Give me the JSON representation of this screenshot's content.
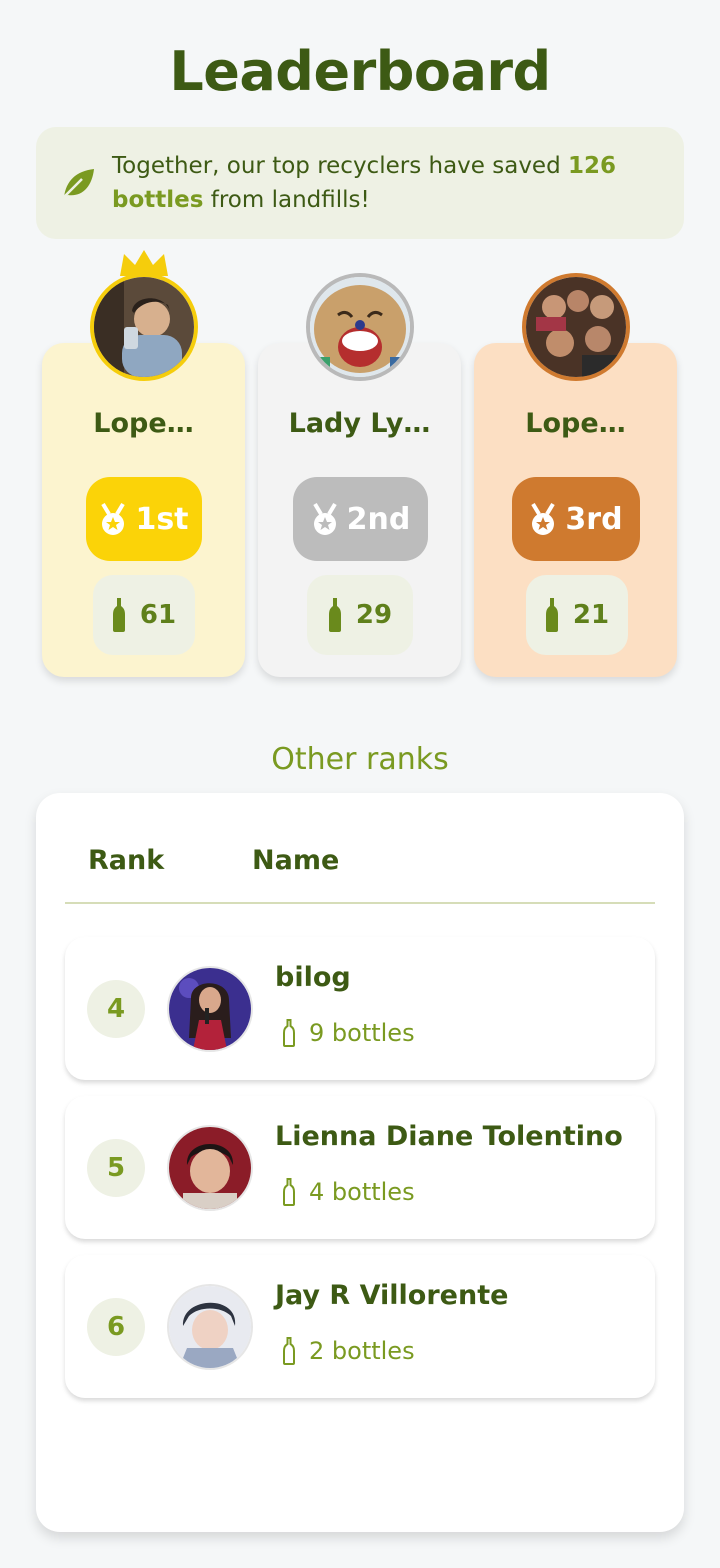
{
  "page": {
    "title": "Leaderboard"
  },
  "banner": {
    "text_before": "Together, our top recyclers have saved ",
    "highlight": "126 bottles",
    "text_after": " from landfills!"
  },
  "podium": [
    {
      "name": "Lope…",
      "place": "1st",
      "bottles": "61",
      "color": "#fbd308"
    },
    {
      "name": "Lady Ly…",
      "place": "2nd",
      "bottles": "29",
      "color": "#bcbcbc"
    },
    {
      "name": "Lope…",
      "place": "3rd",
      "bottles": "21",
      "color": "#cf7a2f"
    }
  ],
  "other": {
    "title": "Other ranks",
    "headers": {
      "rank": "Rank",
      "name": "Name"
    },
    "rows": [
      {
        "rank": "4",
        "name": "bilog",
        "bottles": "9 bottles"
      },
      {
        "rank": "5",
        "name": "Lienna Diane Tolentino",
        "bottles": "4 bottles"
      },
      {
        "rank": "6",
        "name": "Jay R Villorente",
        "bottles": "2 bottles"
      }
    ]
  },
  "colors": {
    "primary": "#3d5a14",
    "accent": "#7a9a21",
    "gold": "#fbd308",
    "silver": "#bcbcbc",
    "bronze": "#cf7a2f"
  },
  "icons": {
    "banner": "leaf-icon",
    "badge": "medal-icon",
    "count": "bottle-icon",
    "first_place": "crown-icon"
  }
}
